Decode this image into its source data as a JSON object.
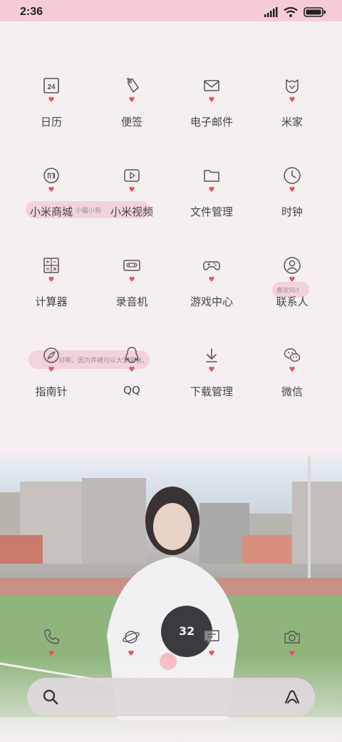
{
  "status_bar": {
    "time": "2:36",
    "icons": [
      "signal-icon",
      "wifi-icon",
      "battery-icon"
    ]
  },
  "apps": [
    {
      "label": "日历",
      "icon": "calendar-icon",
      "icon_text": "24"
    },
    {
      "label": "便签",
      "icon": "tag-icon"
    },
    {
      "label": "电子邮件",
      "icon": "mail-icon"
    },
    {
      "label": "米家",
      "icon": "mijia-icon"
    },
    {
      "label": "小米商城",
      "icon": "mi-store-icon"
    },
    {
      "label": "小米视频",
      "icon": "video-play-icon"
    },
    {
      "label": "文件管理",
      "icon": "folder-icon"
    },
    {
      "label": "时钟",
      "icon": "clock-icon"
    },
    {
      "label": "计算器",
      "icon": "calculator-icon"
    },
    {
      "label": "录音机",
      "icon": "cassette-icon"
    },
    {
      "label": "游戏中心",
      "icon": "gamepad-icon"
    },
    {
      "label": "联系人",
      "icon": "contact-icon"
    },
    {
      "label": "指南针",
      "icon": "compass-icon"
    },
    {
      "label": "QQ",
      "icon": "qq-penguin-icon"
    },
    {
      "label": "下载管理",
      "icon": "download-icon"
    },
    {
      "label": "微信",
      "icon": "wechat-icon"
    }
  ],
  "bubbles": {
    "row2": "小猫小狗",
    "row3": "喜欢吗?",
    "row4": "对啊，因为养猪可以大家来看。"
  },
  "dock": [
    {
      "icon": "phone-icon"
    },
    {
      "icon": "browser-planet-icon"
    },
    {
      "icon": "messages-icon"
    },
    {
      "icon": "camera-icon"
    }
  ],
  "search": {
    "icon": "search-icon",
    "assistant_icon": "ai-assistant-icon"
  },
  "colors": {
    "status_bar": "#f6cdd6",
    "heart": "#e5535f",
    "icon_stroke": "#5a5256",
    "label": "#4a4246"
  }
}
